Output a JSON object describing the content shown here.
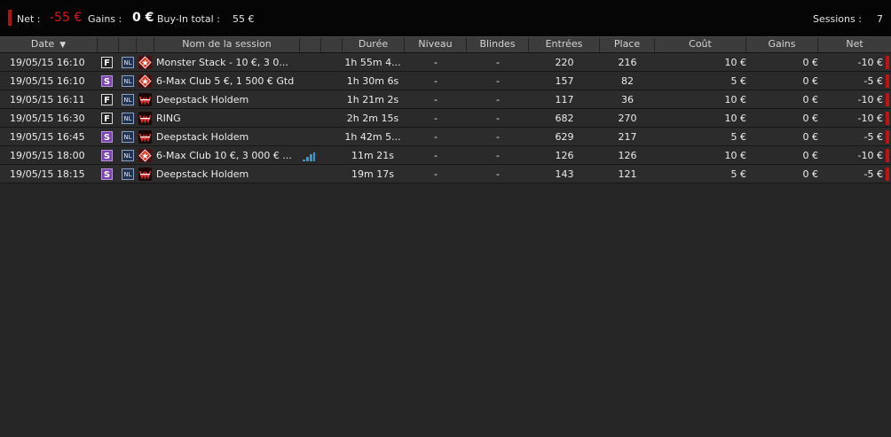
{
  "summary": {
    "net_label": "Net :",
    "net_value": "-55 €",
    "gains_label": "Gains :",
    "gains_value": "0 €",
    "buyin_label": "Buy-In total :",
    "buyin_value": "55 €",
    "sessions_label": "Sessions :",
    "sessions_value": "7"
  },
  "columns": {
    "date": "Date",
    "name": "Nom de la session",
    "duree": "Durée",
    "niveau": "Niveau",
    "blindes": "Blindes",
    "entrees": "Entrées",
    "place": "Place",
    "cout": "Coût",
    "gains": "Gains",
    "net": "Net"
  },
  "sort_indicator": "▼",
  "colors": {
    "negative": "#e0151b",
    "badge_S": "#7b44b0",
    "net_marker": "#c01414",
    "chart_icon": "#2f9ad8"
  },
  "rows": [
    {
      "date": "19/05/15 16:10",
      "type": "F",
      "game": "NL",
      "room": "pokerstars-icon",
      "name": "Monster Stack - 10 €, 3 0...",
      "has_chart": false,
      "duree": "1h 55m 4...",
      "niveau": "-",
      "blindes": "-",
      "entrees": "220",
      "place": "216",
      "cout": "10 €",
      "gains": "0 €",
      "net": "-10 €"
    },
    {
      "date": "19/05/15 16:10",
      "type": "S",
      "game": "NL",
      "room": "pokerstars-icon",
      "name": "6-Max Club 5 €, 1 500 € Gtd",
      "has_chart": false,
      "duree": "1h 30m 6s",
      "niveau": "-",
      "blindes": "-",
      "entrees": "157",
      "place": "82",
      "cout": "5 €",
      "gains": "0 €",
      "net": "-5 €"
    },
    {
      "date": "19/05/15 16:11",
      "type": "F",
      "game": "NL",
      "room": "winamax-icon",
      "name": "Deepstack Holdem",
      "has_chart": false,
      "duree": "1h 21m 2s",
      "niveau": "-",
      "blindes": "-",
      "entrees": "117",
      "place": "36",
      "cout": "10 €",
      "gains": "0 €",
      "net": "-10 €"
    },
    {
      "date": "19/05/15 16:30",
      "type": "F",
      "game": "NL",
      "room": "winamax-icon",
      "name": "RING",
      "has_chart": false,
      "duree": "2h 2m 15s",
      "niveau": "-",
      "blindes": "-",
      "entrees": "682",
      "place": "270",
      "cout": "10 €",
      "gains": "0 €",
      "net": "-10 €"
    },
    {
      "date": "19/05/15 16:45",
      "type": "S",
      "game": "NL",
      "room": "winamax-icon",
      "name": "Deepstack Holdem",
      "has_chart": false,
      "duree": "1h 42m 5...",
      "niveau": "-",
      "blindes": "-",
      "entrees": "629",
      "place": "217",
      "cout": "5 €",
      "gains": "0 €",
      "net": "-5 €"
    },
    {
      "date": "19/05/15 18:00",
      "type": "S",
      "game": "NL",
      "room": "pokerstars-icon",
      "name": "6-Max Club 10 €, 3 000 € ...",
      "has_chart": true,
      "duree": "11m 21s",
      "niveau": "-",
      "blindes": "-",
      "entrees": "126",
      "place": "126",
      "cout": "10 €",
      "gains": "0 €",
      "net": "-10 €"
    },
    {
      "date": "19/05/15 18:15",
      "type": "S",
      "game": "NL",
      "room": "winamax-icon",
      "name": "Deepstack Holdem",
      "has_chart": false,
      "duree": "19m 17s",
      "niveau": "-",
      "blindes": "-",
      "entrees": "143",
      "place": "121",
      "cout": "5 €",
      "gains": "0 €",
      "net": "-5 €"
    }
  ]
}
